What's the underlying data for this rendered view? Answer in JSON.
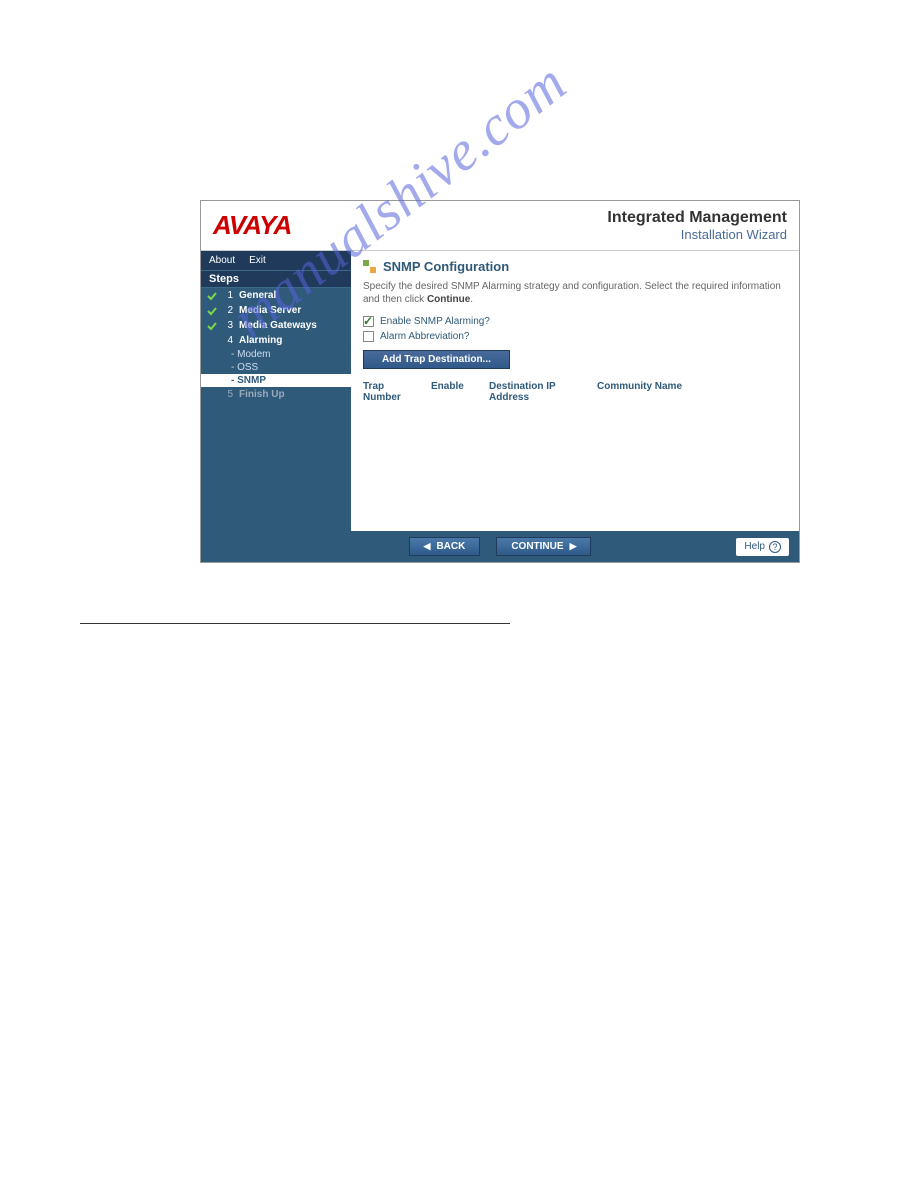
{
  "watermark": "manualshive.com",
  "header": {
    "logo": "AVAYA",
    "title": "Integrated Management",
    "subtitle": "Installation Wizard"
  },
  "sidebar": {
    "menu": {
      "about": "About",
      "exit": "Exit"
    },
    "steps_label": "Steps",
    "items": [
      {
        "num": "1",
        "label": "General",
        "done": true
      },
      {
        "num": "2",
        "label": "Media Server",
        "done": true
      },
      {
        "num": "3",
        "label": "Media Gateways",
        "done": true
      },
      {
        "num": "4",
        "label": "Alarming",
        "done": false,
        "subs": [
          {
            "label": "Modem",
            "sel": false
          },
          {
            "label": "OSS",
            "sel": false
          },
          {
            "label": "SNMP",
            "sel": true
          }
        ]
      },
      {
        "num": "5",
        "label": "Finish Up",
        "done": false,
        "dim": true
      }
    ]
  },
  "content": {
    "section_title": "SNMP Configuration",
    "desc_pre": "Specify the desired SNMP Alarming strategy and configuration. Select the required information and then click ",
    "desc_bold": "Continue",
    "desc_post": ".",
    "enable_label": "Enable SNMP Alarming?",
    "abbrev_label": "Alarm Abbreviation?",
    "add_btn": "Add Trap Destination...",
    "cols": {
      "trap": "Trap Number",
      "enable": "Enable",
      "dest": "Destination IP Address",
      "comm": "Community Name"
    }
  },
  "footer": {
    "back": "BACK",
    "continue": "CONTINUE",
    "help": "Help"
  }
}
